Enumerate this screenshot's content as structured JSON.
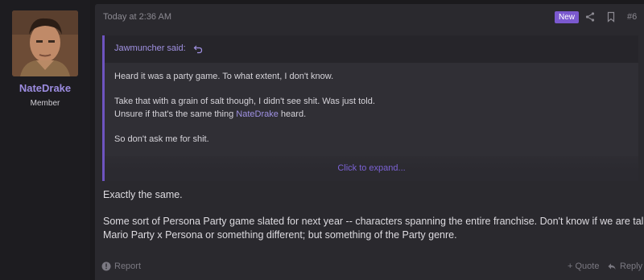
{
  "user": {
    "name": "NateDrake",
    "title": "Member",
    "avatar": "avatar"
  },
  "post": {
    "timestamp": "Today at 2:36 AM",
    "badge": "New",
    "number": "#6",
    "icons": [
      "share-icon",
      "bookmark-icon"
    ]
  },
  "quote": {
    "author": "Jawmuncher said:",
    "line1": "Heard it was a party game. To what extent, I don't know.",
    "line2": "Take that with a grain of salt though, I didn't see shit. Was just told.",
    "line3_pre": "Unsure if that's the same thing ",
    "line3_mention": "NateDrake",
    "line3_post": " heard.",
    "line4": "So don't ask me for shit.",
    "expand": "Click to expand..."
  },
  "message": {
    "line1": "Exactly the same.",
    "line2": "Some sort of Persona Party game slated for next year -- characters spanning the entire franchise. Don't know if we are talking",
    "line3": "Mario Party x Persona or something different; but something of the Party genre."
  },
  "footer": {
    "report": "Report",
    "quote": "+ Quote",
    "reply": "Reply"
  },
  "colors": {
    "accent": "#7b59cf",
    "link": "#9c8ce0",
    "background": "#1b1a1d",
    "post_bg": "#2a292e"
  }
}
